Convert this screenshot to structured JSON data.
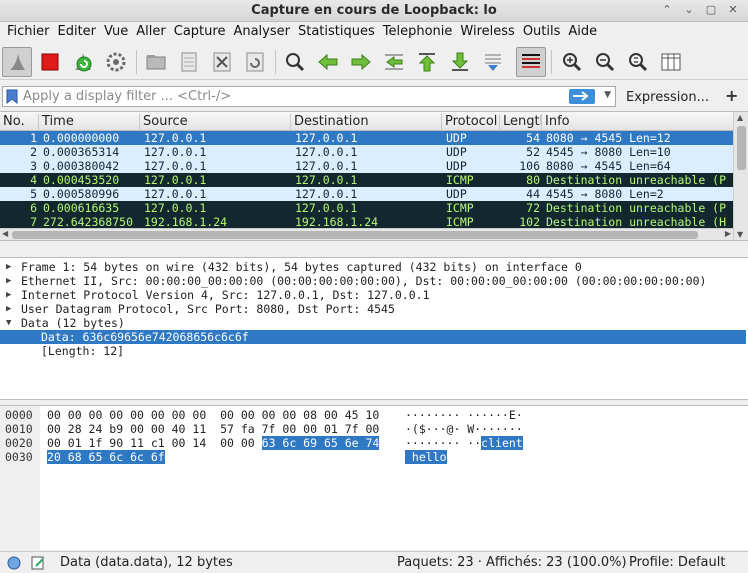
{
  "window": {
    "title": "Capture en cours de Loopback: lo"
  },
  "menu": [
    {
      "label": "Fichier"
    },
    {
      "label": "Editer"
    },
    {
      "label": "Vue"
    },
    {
      "label": "Aller"
    },
    {
      "label": "Capture"
    },
    {
      "label": "Analyser"
    },
    {
      "label": "Statistiques"
    },
    {
      "label": "Telephonie"
    },
    {
      "label": "Wireless"
    },
    {
      "label": "Outils"
    },
    {
      "label": "Aide"
    }
  ],
  "toolbar": {
    "icons": [
      "shark-fin-icon",
      "stop-capture-icon",
      "restart-capture-icon",
      "capture-options-icon",
      "open-file-icon",
      "save-file-icon",
      "close-file-icon",
      "reload-file-icon",
      "find-packet-icon",
      "go-back-icon",
      "go-forward-icon",
      "go-to-packet-icon",
      "first-packet-icon",
      "last-packet-icon",
      "autoscroll-icon",
      "colorize-icon",
      "zoom-in-icon",
      "zoom-out-icon",
      "normal-size-icon",
      "resize-columns-icon"
    ]
  },
  "filter": {
    "placeholder": "Apply a display filter ... <Ctrl-/>",
    "expression_label": "Expression...",
    "plus_label": "+"
  },
  "packet_list": {
    "columns": [
      "No.",
      "Time",
      "Source",
      "Destination",
      "Protocol",
      "Length",
      "Info"
    ],
    "rows": [
      {
        "no": "1",
        "time": "0.000000000",
        "src": "127.0.0.1",
        "dst": "127.0.0.1",
        "proto": "UDP",
        "len": "54",
        "info": "8080 → 4545 Len=12",
        "style": "selected"
      },
      {
        "no": "2",
        "time": "0.000365314",
        "src": "127.0.0.1",
        "dst": "127.0.0.1",
        "proto": "UDP",
        "len": "52",
        "info": "4545 → 8080 Len=10",
        "style": "udp"
      },
      {
        "no": "3",
        "time": "0.000380042",
        "src": "127.0.0.1",
        "dst": "127.0.0.1",
        "proto": "UDP",
        "len": "106",
        "info": "8080 → 4545 Len=64",
        "style": "udp"
      },
      {
        "no": "4",
        "time": "0.000453520",
        "src": "127.0.0.1",
        "dst": "127.0.0.1",
        "proto": "ICMP",
        "len": "80",
        "info": "Destination unreachable (P",
        "style": "icmp"
      },
      {
        "no": "5",
        "time": "0.000580996",
        "src": "127.0.0.1",
        "dst": "127.0.0.1",
        "proto": "UDP",
        "len": "44",
        "info": "4545 → 8080 Len=2",
        "style": "udp"
      },
      {
        "no": "6",
        "time": "0.000616635",
        "src": "127.0.0.1",
        "dst": "127.0.0.1",
        "proto": "ICMP",
        "len": "72",
        "info": "Destination unreachable (P",
        "style": "icmp"
      },
      {
        "no": "7",
        "time": "272.642368750",
        "src": "192.168.1.24",
        "dst": "192.168.1.24",
        "proto": "ICMP",
        "len": "102",
        "info": "Destination unreachable (H",
        "style": "icmp"
      },
      {
        "no": "8",
        "time": "273.281445008",
        "src": "192.168.122.1",
        "dst": "192.168.122.1",
        "proto": "ICMP",
        "len": "102",
        "info": "Destination unreachable (H",
        "style": "icmp"
      }
    ]
  },
  "details": [
    {
      "expanded": false,
      "text": "Frame 1: 54 bytes on wire (432 bits), 54 bytes captured (432 bits) on interface 0"
    },
    {
      "expanded": false,
      "text": "Ethernet II, Src: 00:00:00_00:00:00 (00:00:00:00:00:00), Dst: 00:00:00_00:00:00 (00:00:00:00:00:00)"
    },
    {
      "expanded": false,
      "text": "Internet Protocol Version 4, Src: 127.0.0.1, Dst: 127.0.0.1"
    },
    {
      "expanded": false,
      "text": "User Datagram Protocol, Src Port: 8080, Dst Port: 4545"
    },
    {
      "expanded": true,
      "text": "Data (12 bytes)"
    },
    {
      "child": true,
      "selected": true,
      "text": "Data: 636c69656e742068656c6c6f"
    },
    {
      "child": true,
      "text": "[Length: 12]"
    }
  ],
  "bytes": [
    {
      "off": "0000",
      "hex": "00 00 00 00 00 00 00 00  00 00 00 00 08 00 45 10",
      "hex_sel": "",
      "ascii": "········ ······E·",
      "ascii_sel": ""
    },
    {
      "off": "0010",
      "hex": "00 28 24 b9 00 00 40 11  57 fa 7f 00 00 01 7f 00",
      "hex_sel": "",
      "ascii": "·($···@· W·······",
      "ascii_sel": ""
    },
    {
      "off": "0020",
      "hex": "00 01 1f 90 11 c1 00 14  00 00 ",
      "hex_sel": "63 6c 69 65 6e 74",
      "ascii": "········ ··",
      "ascii_sel": "client"
    },
    {
      "off": "0030",
      "hex": "",
      "hex_sel": "20 68 65 6c 6c 6f",
      "ascii": "",
      "ascii_sel": " hello"
    }
  ],
  "status": {
    "field": "Data (data.data), 12 bytes",
    "packets": "Paquets: 23 · Affichés: 23 (100.0%)",
    "profile": "Profile: Default"
  },
  "colors": {
    "selected_bg": "#2f78c4",
    "udp_bg": "#daeeff",
    "icmp_bg": "#12272e",
    "icmp_fg": "#b7f774"
  }
}
